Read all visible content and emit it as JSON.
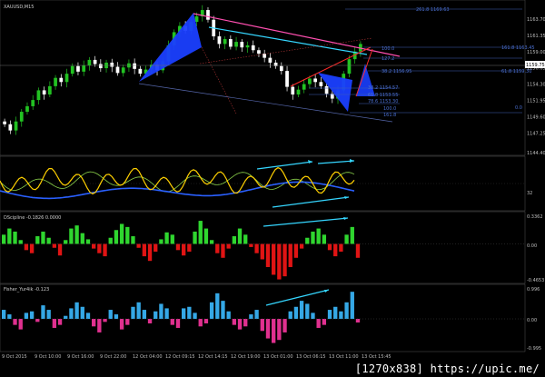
{
  "chart_data": [
    {
      "panel": "price",
      "type": "candlestick",
      "title": "XAUUSD,M15",
      "ylim": [
        1144.4,
        1165.4
      ],
      "yticks": [
        "1144.40",
        "1147.25",
        "1149.60",
        "1151.95",
        "1154.30",
        "1156.65",
        "1159.00",
        "1161.35",
        "1163.70"
      ],
      "current_price": "1159.75",
      "xticks": [
        "9 Oct 2015",
        "9 Oct 10:00",
        "9 Oct 16:00",
        "9 Oct 22:00",
        "12 Oct 04:00",
        "12 Oct 09:15",
        "12 Oct 14:15",
        "12 Oct 19:00",
        "13 Oct 01:00",
        "13 Oct 06:15",
        "13 Oct 11:00",
        "13 Oct 15:45"
      ],
      "closes": [
        1148.5,
        1147.6,
        1148.9,
        1150.3,
        1151.1,
        1152.0,
        1153.4,
        1152.8,
        1154.0,
        1155.2,
        1154.6,
        1155.8,
        1156.9,
        1156.1,
        1157.0,
        1157.8,
        1157.2,
        1156.6,
        1157.4,
        1156.8,
        1155.9,
        1156.7,
        1157.3,
        1156.5,
        1155.8,
        1156.4,
        1157.1,
        1156.3,
        1157.6,
        1159.9,
        1161.8,
        1162.7,
        1162.0,
        1163.3,
        1164.1,
        1165.0,
        1163.6,
        1161.2,
        1160.1,
        1160.8,
        1159.7,
        1160.4,
        1159.6,
        1159.9,
        1159.2,
        1158.7,
        1158.1,
        1157.4,
        1156.9,
        1156.2,
        1153.9,
        1152.8,
        1153.5,
        1154.3,
        1155.1,
        1154.6,
        1154.0,
        1152.9,
        1152.2,
        1153.4,
        1155.8,
        1157.9,
        1159.0,
        1160.1
      ],
      "pattern_labels": [
        "261.8 1169.63",
        "161.8 1163.45",
        "127.2",
        "100.0",
        "61.8 1159.30",
        "38.2 1156.95",
        "23.6",
        "0.0",
        "38.2 1154.57",
        "61.8 1153.55",
        "78.6 1153.30",
        "100.0",
        "161.8"
      ]
    },
    {
      "panel": "oscillator-1",
      "type": "line",
      "yticks": [
        "32"
      ]
    },
    {
      "panel": "oscillator-2",
      "type": "bar",
      "title": "DScipline -0.1826 0.0000",
      "ylim": [
        -0.4653,
        0.3362
      ],
      "yticks": [
        "0.3362",
        "0.00",
        "-0.4653"
      ],
      "values": [
        0.12,
        0.2,
        0.16,
        0.05,
        -0.08,
        -0.12,
        0.1,
        0.16,
        0.08,
        -0.05,
        -0.15,
        0.05,
        0.2,
        0.24,
        0.14,
        0.06,
        -0.06,
        -0.12,
        -0.16,
        0.08,
        0.18,
        0.26,
        0.22,
        0.1,
        -0.05,
        -0.16,
        -0.22,
        -0.1,
        0.06,
        0.15,
        0.12,
        -0.08,
        -0.15,
        -0.1,
        0.16,
        0.3,
        0.2,
        0.05,
        -0.12,
        -0.18,
        -0.06,
        0.1,
        0.2,
        0.12,
        -0.04,
        -0.12,
        -0.2,
        -0.3,
        -0.4,
        -0.46,
        -0.42,
        -0.3,
        -0.18,
        -0.06,
        0.08,
        0.16,
        0.2,
        0.12,
        -0.08,
        -0.16,
        -0.1,
        0.12,
        0.22,
        -0.18
      ]
    },
    {
      "panel": "oscillator-3",
      "type": "bar",
      "title": "Fisher_Yur4ik -0.123",
      "ylim": [
        -0.995,
        0.996
      ],
      "yticks": [
        "0.996",
        "0.00",
        "-0.995"
      ],
      "values": [
        0.3,
        0.15,
        -0.2,
        -0.35,
        0.2,
        0.25,
        -0.1,
        0.45,
        0.3,
        -0.3,
        -0.2,
        0.1,
        0.35,
        0.55,
        0.4,
        0.2,
        -0.25,
        -0.45,
        -0.1,
        0.3,
        0.15,
        -0.35,
        -0.2,
        0.4,
        0.55,
        0.3,
        -0.15,
        0.25,
        0.5,
        0.35,
        -0.2,
        -0.3,
        0.35,
        0.4,
        0.2,
        -0.25,
        -0.15,
        0.55,
        0.85,
        0.6,
        0.25,
        -0.2,
        -0.35,
        -0.25,
        0.15,
        0.3,
        -0.4,
        -0.65,
        -0.8,
        -0.7,
        -0.45,
        0.25,
        0.4,
        0.6,
        0.5,
        0.2,
        -0.3,
        -0.2,
        0.3,
        0.4,
        0.25,
        0.55,
        0.9,
        -0.12
      ]
    }
  ],
  "watermark": "[1270x838] https://upic.me/",
  "colors": {
    "background": "#000000",
    "bull": "#22c222",
    "bear": "#ffffff",
    "pattern_fill": "#1a3fff",
    "osc_line_1": "#ffd000",
    "osc_line_2": "#8ad04a",
    "osc_line_3": "#2a60ff",
    "cyan_arrow": "#35d6ff",
    "pink": "#ff4fb0",
    "red_line": "#ff2a2a",
    "hist_pos_2": "#2fd62f",
    "hist_neg_2": "#e01414",
    "hist_pos_3": "#35a8e6",
    "hist_neg_3": "#e0308f",
    "grid": "#505050"
  }
}
